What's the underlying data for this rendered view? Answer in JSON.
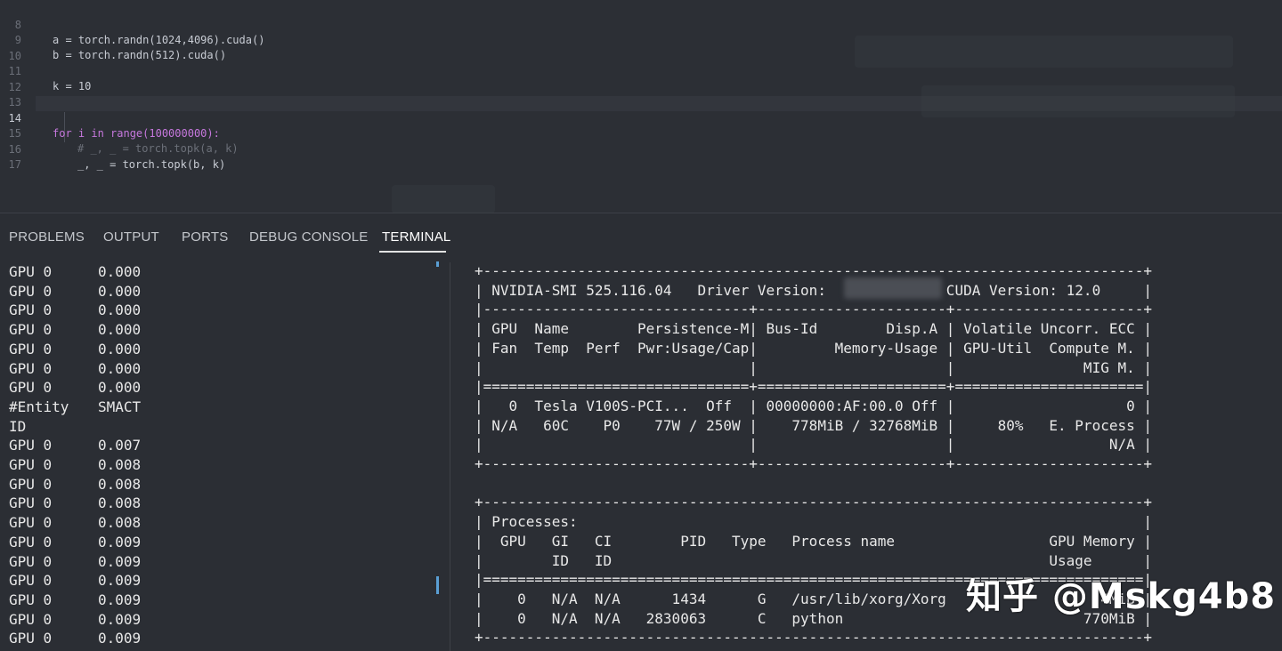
{
  "editor": {
    "lines": [
      {
        "num": "8",
        "text": "a = torch.randn(1024,4096).cuda()"
      },
      {
        "num": "9",
        "text": "b = torch.randn(512).cuda()"
      },
      {
        "num": "10",
        "text": ""
      },
      {
        "num": "11",
        "text": "k = 10"
      },
      {
        "num": "12",
        "text": ""
      },
      {
        "num": "13",
        "text": ""
      },
      {
        "num": "14",
        "text": "for i in range(100000000):"
      },
      {
        "num": "15",
        "text": "# _, _ = torch.topk(a, k)"
      },
      {
        "num": "16",
        "text": "_, _ = torch.topk(b, k)"
      },
      {
        "num": "17",
        "text": ""
      }
    ]
  },
  "panel": {
    "tabs": [
      "PROBLEMS",
      "OUTPUT",
      "PORTS",
      "DEBUG CONSOLE",
      "TERMINAL"
    ],
    "active_tab": "TERMINAL"
  },
  "terminal_left": {
    "rows": [
      [
        "GPU 0",
        "0.000"
      ],
      [
        "GPU 0",
        "0.000"
      ],
      [
        "GPU 0",
        "0.000"
      ],
      [
        "GPU 0",
        "0.000"
      ],
      [
        "GPU 0",
        "0.000"
      ],
      [
        "GPU 0",
        "0.000"
      ],
      [
        "GPU 0",
        "0.000"
      ],
      [
        "#Entity",
        "SMACT"
      ],
      [
        "ID",
        ""
      ],
      [
        "GPU 0",
        "0.007"
      ],
      [
        "GPU 0",
        "0.008"
      ],
      [
        "GPU 0",
        "0.008"
      ],
      [
        "GPU 0",
        "0.008"
      ],
      [
        "GPU 0",
        "0.008"
      ],
      [
        "GPU 0",
        "0.009"
      ],
      [
        "GPU 0",
        "0.009"
      ],
      [
        "GPU 0",
        "0.009"
      ],
      [
        "GPU 0",
        "0.009"
      ],
      [
        "GPU 0",
        "0.009"
      ],
      [
        "GPU 0",
        "0.009"
      ]
    ]
  },
  "nvidia_smi": {
    "lines": [
      "+-----------------------------------------------------------------------------+",
      "| NVIDIA-SMI 525.116.04   Driver Version:              CUDA Version: 12.0     |",
      "|-------------------------------+----------------------+----------------------+",
      "| GPU  Name        Persistence-M| Bus-Id        Disp.A | Volatile Uncorr. ECC |",
      "| Fan  Temp  Perf  Pwr:Usage/Cap|         Memory-Usage | GPU-Util  Compute M. |",
      "|                               |                      |               MIG M. |",
      "|===============================+======================+======================|",
      "|   0  Tesla V100S-PCI...  Off  | 00000000:AF:00.0 Off |                    0 |",
      "| N/A   60C    P0    77W / 250W |    778MiB / 32768MiB |     80%   E. Process |",
      "|                               |                      |                  N/A |",
      "+-------------------------------+----------------------+----------------------+",
      "",
      "+-----------------------------------------------------------------------------+",
      "| Processes:                                                                  |",
      "|  GPU   GI   CI        PID   Type   Process name                  GPU Memory |",
      "|        ID   ID                                                   Usage      |",
      "|=============================================================================|",
      "|    0   N/A  N/A      1434      G   /usr/lib/xorg/Xorg                  4MiB |",
      "|    0   N/A  N/A   2830063      C   python                            770MiB |",
      "+-----------------------------------------------------------------------------+"
    ]
  },
  "watermark": "知乎 @Mskg4b8"
}
